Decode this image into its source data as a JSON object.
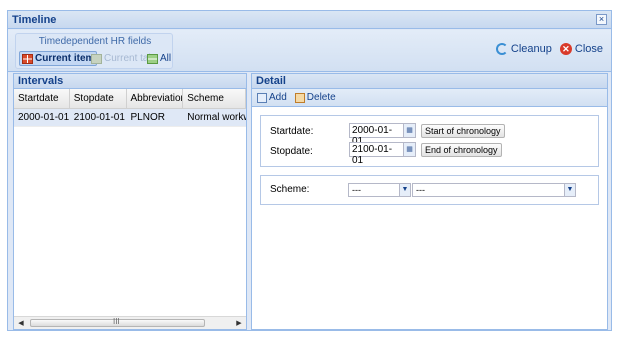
{
  "window": {
    "title": "Timeline",
    "close_glyph": "×"
  },
  "toolbar": {
    "group_title": "Timedependent HR fields",
    "buttons": [
      {
        "label": "Current item",
        "icon": "current-item-icon",
        "state": "active"
      },
      {
        "label": "Current tab",
        "icon": "current-tab-icon",
        "state": "disabled"
      },
      {
        "label": "All",
        "icon": "all-icon",
        "state": "normal"
      }
    ],
    "cleanup_label": "Cleanup",
    "close_label": "Close"
  },
  "intervals": {
    "title": "Intervals",
    "columns": [
      "Startdate",
      "Stopdate",
      "Abbreviation",
      "Scheme"
    ],
    "rows": [
      [
        "2000-01-01",
        "2100-01-01",
        "PLNOR",
        "Normal workwe"
      ]
    ],
    "scroll_grip": "III"
  },
  "detail": {
    "title": "Detail",
    "add_label": "Add",
    "delete_label": "Delete",
    "startdate_label": "Startdate:",
    "startdate_value": "2000-01-01",
    "start_button": "Start of chronology",
    "stopdate_label": "Stopdate:",
    "stopdate_value": "2100-01-01",
    "end_button": "End of chronology",
    "scheme_label": "Scheme:",
    "scheme_value_1": "---",
    "scheme_value_2": "---"
  },
  "colors": {
    "header": "#15428b",
    "border": "#99bbe8",
    "selected_row": "#dfe8f6"
  }
}
